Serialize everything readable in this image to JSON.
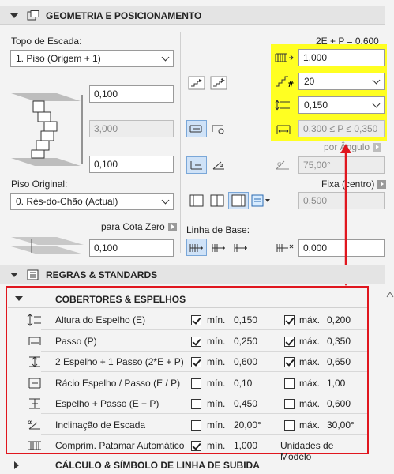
{
  "geometry_section": {
    "title": "GEOMETRIA E POSICIONAMENTO",
    "top_label": "Topo de Escada:",
    "top_select": "1. Piso (Origem + 1)",
    "formula": "2E + P = 0,600",
    "height_top": "0,100",
    "height_mid": "3,000",
    "height_bottom": "0,100",
    "riser_count_field": "1,000",
    "riser_number": "20",
    "riser_height": "0,150",
    "tread_range": "0,300 ≤ P ≤ 0,350",
    "by_angle_label": "por Ângulo",
    "angle_value": "75,00°",
    "fixed_label": "Fixa (centro)",
    "width_value": "0,500",
    "origin_label": "Piso Original:",
    "origin_select": "0. Rés-do-Chão (Actual)",
    "zero_label": "para Cota Zero",
    "zero_value": "0,100",
    "baseline_label": "Linha de Base:",
    "baseline_value": "0,000"
  },
  "rules_section": {
    "title": "REGRAS & STANDARDS",
    "subtitle": "COBERTORES & ESPELHOS",
    "min_label": "mín.",
    "max_label": "máx.",
    "rows": [
      {
        "name": "Altura do Espelho (E)",
        "min_on": true,
        "min": "0,150",
        "max_on": true,
        "max_label": "máx.",
        "max": "0,200"
      },
      {
        "name": "Passo (P)",
        "min_on": true,
        "min": "0,250",
        "max_on": true,
        "max_label": "máx.",
        "max": "0,350"
      },
      {
        "name": "2 Espelho + 1 Passo (2*E + P)",
        "min_on": true,
        "min": "0,600",
        "max_on": true,
        "max_label": "máx.",
        "max": "0,650"
      },
      {
        "name": "Rácio Espelho / Passo (E / P)",
        "min_on": false,
        "min": "0,10",
        "max_on": false,
        "max_label": "máx.",
        "max": "1,00"
      },
      {
        "name": "Espelho + Passo (E + P)",
        "min_on": false,
        "min": "0,450",
        "max_on": false,
        "max_label": "máx.",
        "max": "0,600"
      },
      {
        "name": "Inclinação de Escada",
        "min_on": false,
        "min": "20,00°",
        "max_on": false,
        "max_label": "máx.",
        "max": "30,00°"
      },
      {
        "name": "Comprim. Patamar Automático",
        "min_on": true,
        "min": "1,000",
        "max_on": null,
        "max_label": "Unidades de Modelo",
        "max": ""
      }
    ]
  },
  "calc_section": {
    "title": "CÁLCULO & SÍMBOLO DE LINHA DE SUBIDA"
  },
  "colors": {
    "highlight": "#ffff22",
    "annotation": "#e0161e"
  }
}
